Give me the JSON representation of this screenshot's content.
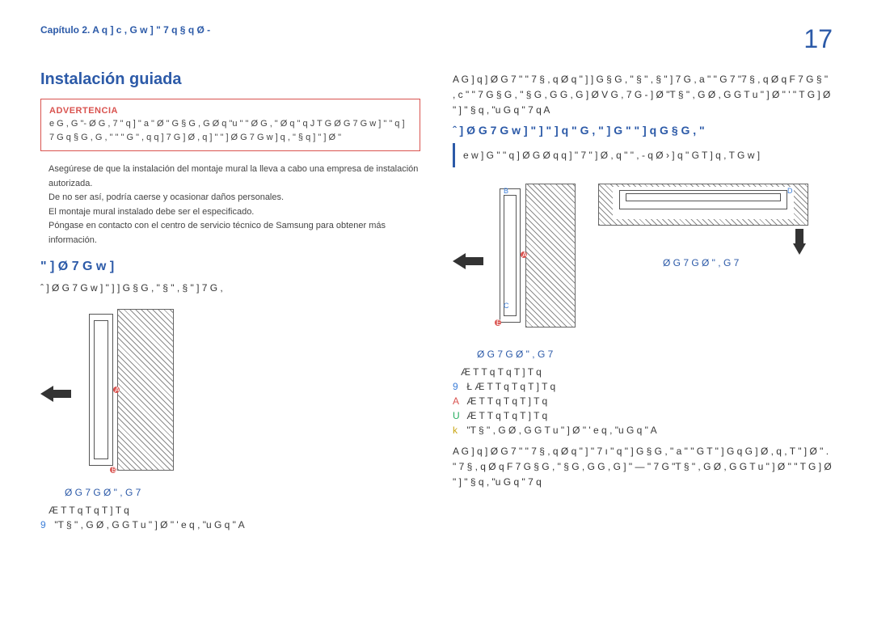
{
  "header": {
    "chapter": "Capítulo 2.  A q ] c   , G    w ]    \" 7  q   § q    Ø  -",
    "page_number": "17"
  },
  "left": {
    "title": "Instalación guiada",
    "warning_label": "ADVERTENCIA",
    "warning_body": "e G , G   \"- Ø G ,   7 \"   q ] \"   a   \" Ø \"   G § G , G Ø q   \"u \"   \"   Ø G ,    \" Ø q   \"    q J T G Ø G 7 G   w ] \"   \" q    ] 7 G q § G , G , \"   \"   \" G   \"   ,   q   q ]   7 G          ]   Ø ,      q ] \"      \"     ]   Ø G 7 G   w ]   q , \"   § q ]    \" ] Ø \"",
    "info1": "Asegúrese de que la instalación del montaje mural la lleva a cabo una empresa de instalación autorizada.",
    "info2": "De no ser así, podría caerse y ocasionar daños personales.",
    "info3": "El montaje mural instalado debe ser el especificado.",
    "info4": "Póngase en contacto con el centro de servicio técnico de Samsung para obtener más información.",
    "subheading": "\" ] Ø   7 G    w ]",
    "subbody": "ˆ ]   Ø G 7 G   w ] \"  ]   ]  G   § G , \"    § \" , § \" ]     7 G ,",
    "diagram_caption": "Ø G   7 G Ø \" , G 7",
    "legend_pm": "Æ  T T   q T q  T ]  T q",
    "legend_9": "\"T § \" , G Ø  , G  G T u  \" ] Ø \" '  e q ,   \"u G  q   \"       A"
  },
  "right": {
    "para1": "A  G ]  q   ]  Ø G 7 \"  \" 7  § , q   Ø q  \" ]   ]  G  § G , \"   § \" , § \" ]     7 G , a   \"   \"  G 7  \"7  § , q   Ø q  F  7 G    § \" , c   \"   \"  7 G  § G , \"   § G , G  G , G ] Ø  V G ,  7 G  - ] Ø \"T § \" , G Ø  , G  G T u  \" ] Ø \" '    \"  T G ] Ø  \" ] \"  § q ,   \"u G  q   \"   7 q      A",
    "subheading2": "ˆ ]   Ø G 7 G   w ]  \"  ]  \"  ]   q  \" G ,       \"  ] G  \"   \"  ]     q  G  § G , \"",
    "note": "e w ]  G  \"   \"   q ] Ø G  Ø q   q ]  \" 7  \" ] Ø , q   \"   \" , -   q  Ø › ]  q   \"   G T   ] q , T G  w ]",
    "caption_right": "Ø G   7 G Ø \" , G 7",
    "caption_top": "Ø G   7 G Ø \" , G 7",
    "legend_pm2": "Æ  T T   q T q  T ]  T q",
    "legend_9_2": "Ł Æ  T T   q T q  T ]  T q",
    "legend_A": "Æ  T T   q T q  T ]  T q",
    "legend_U": "Æ  T T   q T q  T ]  T q",
    "legend_k": "\"T § \" , G Ø  , G  G T u  \" ] Ø \" '  e q ,   \"u G  q   \"       A",
    "para2": "A G ]  q   ]  Ø G 7 \"  \" 7  § , q   Ø q  \" ]  \" 7  ı   \" q   \"   ]  G  § G , \"  a   \"   \"  G  T \"   ]    G  q  G ] Ø ,   q , T \" ] Ø \" . \" 7  § , q   Ø q  F  7 G  § G , \"   § G , G  G , G ] \"   —   \"  7 G  \"T § \" , G Ø  , G  G T u \" ] Ø \"   \"  T G ] Ø  \" ] \" § q ,  \"u G  q   \"  7 q"
  },
  "markers": {
    "A": "A",
    "B": "B",
    "C": "C",
    "D": "D",
    "E": "E"
  }
}
